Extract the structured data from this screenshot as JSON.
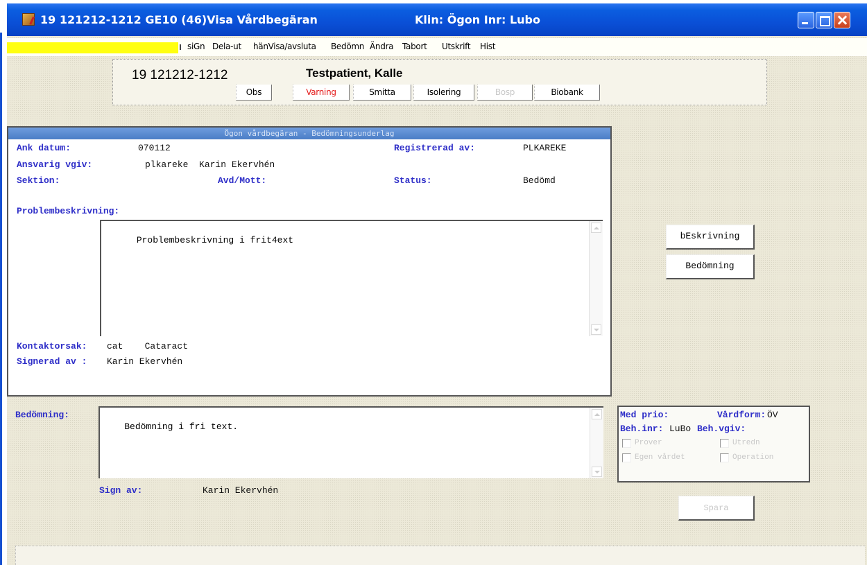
{
  "window": {
    "title_left": "19 121212-1212  GE10 (46)Visa Vårdbegäran",
    "title_right": "Klin: Ögon  Inr: Lubo"
  },
  "menu": {
    "items": [
      "siGn",
      "Dela-ut",
      "hänVisa/avsluta",
      "Bedömn",
      "Ändra",
      "Tabort",
      "Utskrift",
      "Hist"
    ]
  },
  "patient": {
    "id": "19 121212-1212",
    "name": "Testpatient, Kalle",
    "flags": [
      {
        "label": "Obs",
        "state": "normal"
      },
      {
        "label": "Varning",
        "state": "red"
      },
      {
        "label": "Smitta",
        "state": "normal"
      },
      {
        "label": "Isolering",
        "state": "normal"
      },
      {
        "label": "Bosp",
        "state": "disabled"
      },
      {
        "label": "Biobank",
        "state": "normal"
      }
    ]
  },
  "panel": {
    "header": "Ögon vårdbegäran - Bedömningsunderlag",
    "ank_datum_label": "Ank datum:",
    "ank_datum": "070112",
    "registrerad_label": "Registrerad av:",
    "registrerad": "PLKAREKE",
    "ansvarig_label": "Ansvarig vgiv:",
    "ansvarig": "plkareke  Karin Ekervhén",
    "sektion_label": "Sektion:",
    "avd_label": "Avd/Mott:",
    "status_label": "Status:",
    "status": "Bedömd",
    "problem_label": "Problembeskrivning:",
    "problem_text": "Problembeskrivning i frit4ext",
    "kontaktorsak_label": "Kontaktorsak:",
    "kontaktorsak": "cat    Cataract",
    "signerad_label": "Signerad av :",
    "signerad": "Karin Ekervhén"
  },
  "buttons": {
    "beskrivning": "bEskrivning",
    "bedomning": "Bedömning",
    "spara": "Spara"
  },
  "assessment": {
    "label": "Bedömning:",
    "text": "Bedömning i fri text.",
    "sign_label": "Sign av:",
    "sign": "Karin Ekervhén"
  },
  "right_panel": {
    "med_prio_label": "Med prio:",
    "vardform_label": "Vårdform:",
    "vardform": "ÖV",
    "beh_inr_label": "Beh.inr:",
    "beh_inr": "LuBo",
    "beh_vgiv_label": "Beh.vgiv:",
    "checkboxes": [
      "Prover",
      "Utredn",
      "Egen vårdet",
      "Operation"
    ]
  },
  "colors": {
    "title_bar": "#0a4fd6",
    "label_blue": "#2e2ec8",
    "warning_red": "#e41c1c",
    "highlight_yellow": "#ffff10"
  }
}
